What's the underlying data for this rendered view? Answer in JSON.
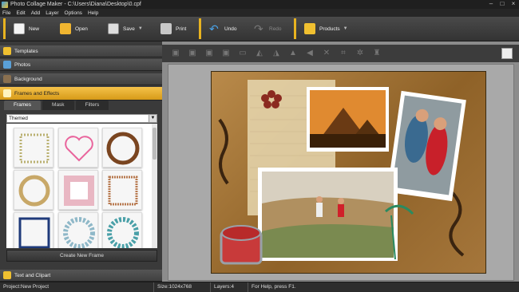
{
  "window": {
    "title": "Photo Collage Maker - C:\\Users\\Diana\\Desktop\\0.cpf"
  },
  "menu": [
    "File",
    "Edit",
    "Add",
    "Layer",
    "Options",
    "Help"
  ],
  "toolbar": {
    "new": "New",
    "open": "Open",
    "save": "Save",
    "print": "Print",
    "undo": "Undo",
    "redo": "Redo",
    "products": "Products"
  },
  "sidebar": {
    "categories": [
      "Templates",
      "Photos",
      "Background",
      "Frames and Effects"
    ],
    "bottom_category": "Text and Clipart",
    "tabs": [
      "Frames",
      "Mask",
      "Filters"
    ],
    "dropdown_value": "Themed",
    "create_button": "Create New Frame"
  },
  "status": {
    "project": "Project:New Project",
    "size": "Size:1024x768",
    "layers": "Layers:4",
    "help": "For Help, press F1."
  },
  "colors": {
    "accent": "#e8b320"
  }
}
